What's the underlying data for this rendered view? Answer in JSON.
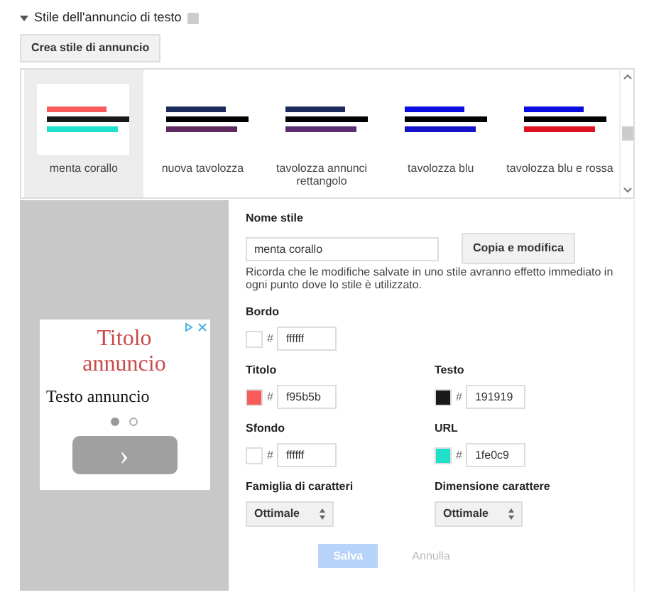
{
  "section": {
    "title": "Stile dell'annuncio di testo",
    "expanded": true
  },
  "create_button": "Crea stile di annuncio",
  "styles": [
    {
      "name": "menta corallo",
      "selected": true,
      "bars": [
        {
          "color": "#f95b5b"
        },
        {
          "color": "#191919"
        },
        {
          "color": "#1fe0c9"
        }
      ]
    },
    {
      "name": "nuova tavolozza",
      "selected": false,
      "bars": [
        {
          "color": "#1c2a5e"
        },
        {
          "color": "#000000"
        },
        {
          "color": "#5c2a5e"
        }
      ]
    },
    {
      "name": "tavolozza annunci rettangolo",
      "selected": false,
      "bars": [
        {
          "color": "#1c2a5e"
        },
        {
          "color": "#000000"
        },
        {
          "color": "#5a2d6e"
        }
      ]
    },
    {
      "name": "tavolozza blu",
      "selected": false,
      "bars": [
        {
          "color": "#0b0de0"
        },
        {
          "color": "#000000"
        },
        {
          "color": "#1414c8"
        }
      ]
    },
    {
      "name": "tavolozza blu e rossa",
      "selected": false,
      "bars": [
        {
          "color": "#0b0de0"
        },
        {
          "color": "#000000"
        },
        {
          "color": "#e01020"
        }
      ]
    }
  ],
  "preview": {
    "title": "Titolo annuncio",
    "text": "Testo annuncio",
    "dots": [
      {
        "selected": true
      },
      {
        "selected": false
      }
    ],
    "next": "›"
  },
  "form": {
    "name_label": "Nome stile",
    "name_value": "menta corallo",
    "copy_button": "Copia e modifica",
    "note": "Ricorda che le modifiche salvate in uno stile avranno effetto immediato in ogni punto dove lo stile è utilizzato.",
    "colors": [
      {
        "label": "Bordo",
        "hash": "#",
        "value": "ffffff",
        "color": "#ffffff"
      },
      {
        "label": "Titolo",
        "hash": "#",
        "value": "f95b5b",
        "color": "#f95b5b"
      },
      {
        "label": "Testo",
        "hash": "#",
        "value": "191919",
        "color": "#191919"
      },
      {
        "label": "Sfondo",
        "hash": "#",
        "value": "ffffff",
        "color": "#ffffff"
      },
      {
        "label": "URL",
        "hash": "#",
        "value": "1fe0c9",
        "color": "#1fe0c9"
      }
    ],
    "selects": [
      {
        "label": "Famiglia di caratteri",
        "value": "Ottimale"
      },
      {
        "label": "Dimensione carattere",
        "value": "Ottimale"
      }
    ],
    "save": {
      "label": "Salva",
      "disabled": true
    },
    "cancel": {
      "label": "Annulla",
      "disabled": true
    }
  }
}
